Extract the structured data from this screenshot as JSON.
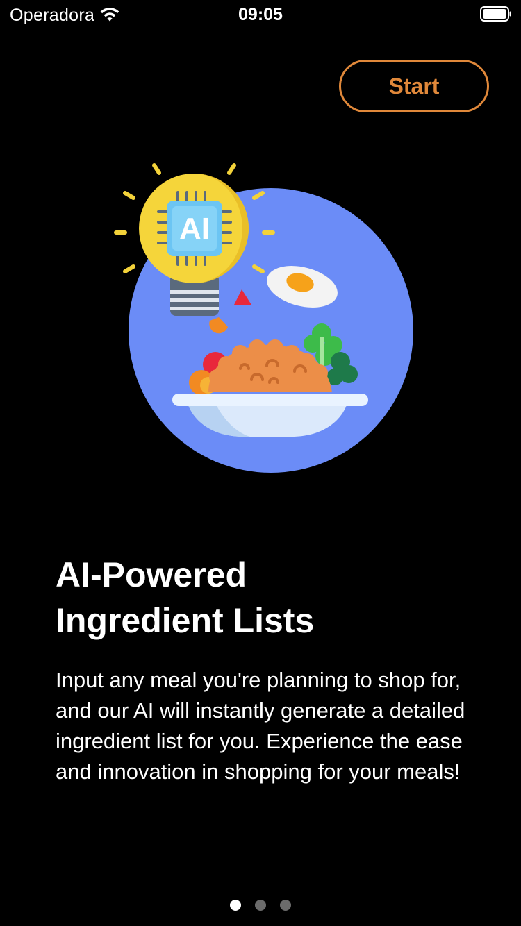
{
  "status_bar": {
    "carrier": "Operadora",
    "time": "09:05",
    "wifi_icon": "wifi-icon",
    "battery_icon": "battery-full-icon"
  },
  "header": {
    "start_label": "Start"
  },
  "illustration": {
    "icon": "ai-lightbulb-meal-illustration",
    "badge_text": "AI"
  },
  "content": {
    "title_line1": "AI-Powered",
    "title_line2": "Ingredient Lists",
    "description": "Input any meal you're planning to shop for, and our AI will instantly generate a detailed ingredient list for you. Experience the ease and innovation in shopping for your meals!"
  },
  "pagination": {
    "current": 1,
    "total": 3
  },
  "colors": {
    "accent": "#e0883a",
    "background": "#000000",
    "circle": "#6b8cf7",
    "dot_active": "#ffffff",
    "dot_inactive": "#6b6b6b"
  }
}
